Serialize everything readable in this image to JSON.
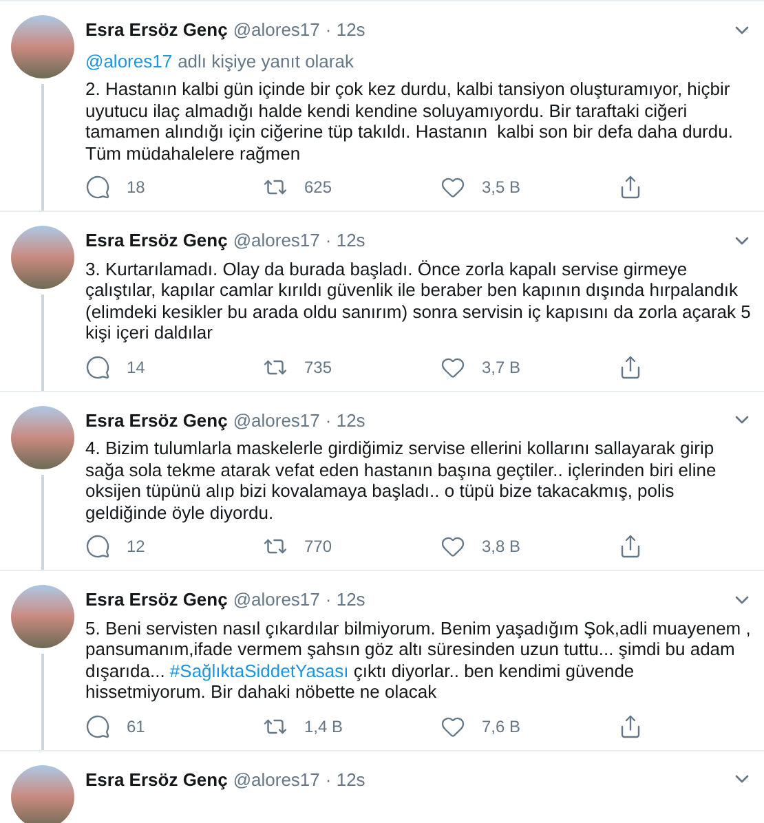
{
  "tweets": [
    {
      "author": "Esra Ersöz Genç",
      "handle": "@alores17",
      "time": "· 12s",
      "reply_to": {
        "handle": "@alores17",
        "suffix": "adlı kişiye yanıt olarak"
      },
      "body": [
        {
          "kind": "text",
          "text": "2. Hastanın kalbi gün içinde bir çok kez durdu, kalbi tansiyon oluşturamıyor, hiçbir uyutucu ilaç almadığı halde kendi kendine soluyamıyordu. Bir taraftaki ciğeri tamamen alındığı için ciğerine tüp takıldı. Hastanın  kalbi son bir defa daha durdu. Tüm müdahalelere rağmen"
        }
      ],
      "stats": {
        "replies": "18",
        "retweets": "625",
        "likes": "3,5 B"
      }
    },
    {
      "author": "Esra Ersöz Genç",
      "handle": "@alores17",
      "time": "· 12s",
      "body": [
        {
          "kind": "text",
          "text": "3. Kurtarılamadı. Olay da burada başladı. Önce zorla kapalı servise girmeye çalıştılar, kapılar camlar kırıldı güvenlik ile beraber ben kapının dışında hırpalandık (elimdeki kesikler bu arada oldu sanırım) sonra servisin iç kapısını da zorla açarak 5 kişi içeri daldılar"
        }
      ],
      "stats": {
        "replies": "14",
        "retweets": "735",
        "likes": "3,7 B"
      }
    },
    {
      "author": "Esra Ersöz Genç",
      "handle": "@alores17",
      "time": "· 12s",
      "body": [
        {
          "kind": "text",
          "text": "4. Bizim tulumlarla maskelerle girdiğimiz servise ellerini kollarını sallayarak girip sağa sola tekme atarak vefat eden hastanın başına geçtiler.. içlerinden biri eline oksijen tüpünü alıp bizi kovalamaya başladı.. o tüpü bize takacakmış, polis geldiğinde öyle diyordu."
        }
      ],
      "stats": {
        "replies": "12",
        "retweets": "770",
        "likes": "3,8 B"
      }
    },
    {
      "author": "Esra Ersöz Genç",
      "handle": "@alores17",
      "time": "· 12s",
      "body": [
        {
          "kind": "text",
          "text": "5. Beni servisten nasıl çıkardılar bilmiyorum. Benim yaşadığım Şok,adli muayenem , pansumanım,ifade vermem şahsın göz altı süresinden uzun tuttu... şimdi bu adam dışarıda... "
        },
        {
          "kind": "hashtag",
          "text": "#SağlıktaSiddetYasası"
        },
        {
          "kind": "text",
          "text": " çıktı diyorlar.. ben kendimi güvende hissetmiyorum. Bir dahaki nöbette ne olacak"
        }
      ],
      "stats": {
        "replies": "61",
        "retweets": "1,4 B",
        "likes": "7,6 B"
      }
    },
    {
      "author": "Esra Ersöz Genç",
      "handle": "@alores17",
      "time": "· 12s"
    }
  ]
}
